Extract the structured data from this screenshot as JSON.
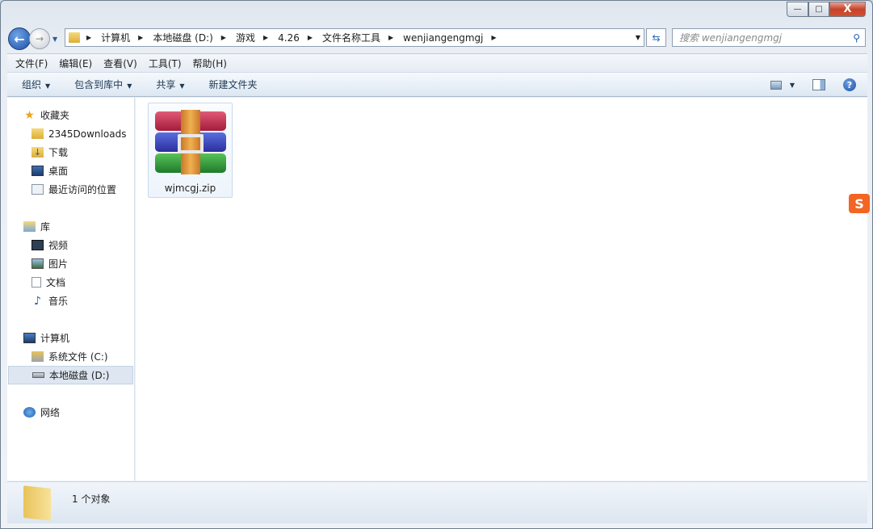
{
  "window": {
    "minimize": "—",
    "maximize": "□",
    "close": "X"
  },
  "address": {
    "crumbs": [
      "计算机",
      "本地磁盘 (D:)",
      "游戏",
      "4.26",
      "文件名称工具",
      "wenjiangengmgj"
    ]
  },
  "search": {
    "placeholder": "搜索 wenjiangengmgj"
  },
  "menu": [
    "文件(F)",
    "编辑(E)",
    "查看(V)",
    "工具(T)",
    "帮助(H)"
  ],
  "toolbar": {
    "organize": "组织",
    "include_library": "包含到库中",
    "share": "共享",
    "new_folder": "新建文件夹"
  },
  "sidebar": {
    "favorites": {
      "label": "收藏夹",
      "items": [
        "2345Downloads",
        "下载",
        "桌面",
        "最近访问的位置"
      ]
    },
    "libraries": {
      "label": "库",
      "items": [
        "视频",
        "图片",
        "文档",
        "音乐"
      ]
    },
    "computer": {
      "label": "计算机",
      "items": [
        "系统文件 (C:)",
        "本地磁盘 (D:)"
      ]
    },
    "network": {
      "label": "网络"
    }
  },
  "files": [
    {
      "name": "wjmcgj.zip"
    }
  ],
  "status": {
    "count": "1 个对象"
  },
  "ime": {
    "label": "S"
  }
}
